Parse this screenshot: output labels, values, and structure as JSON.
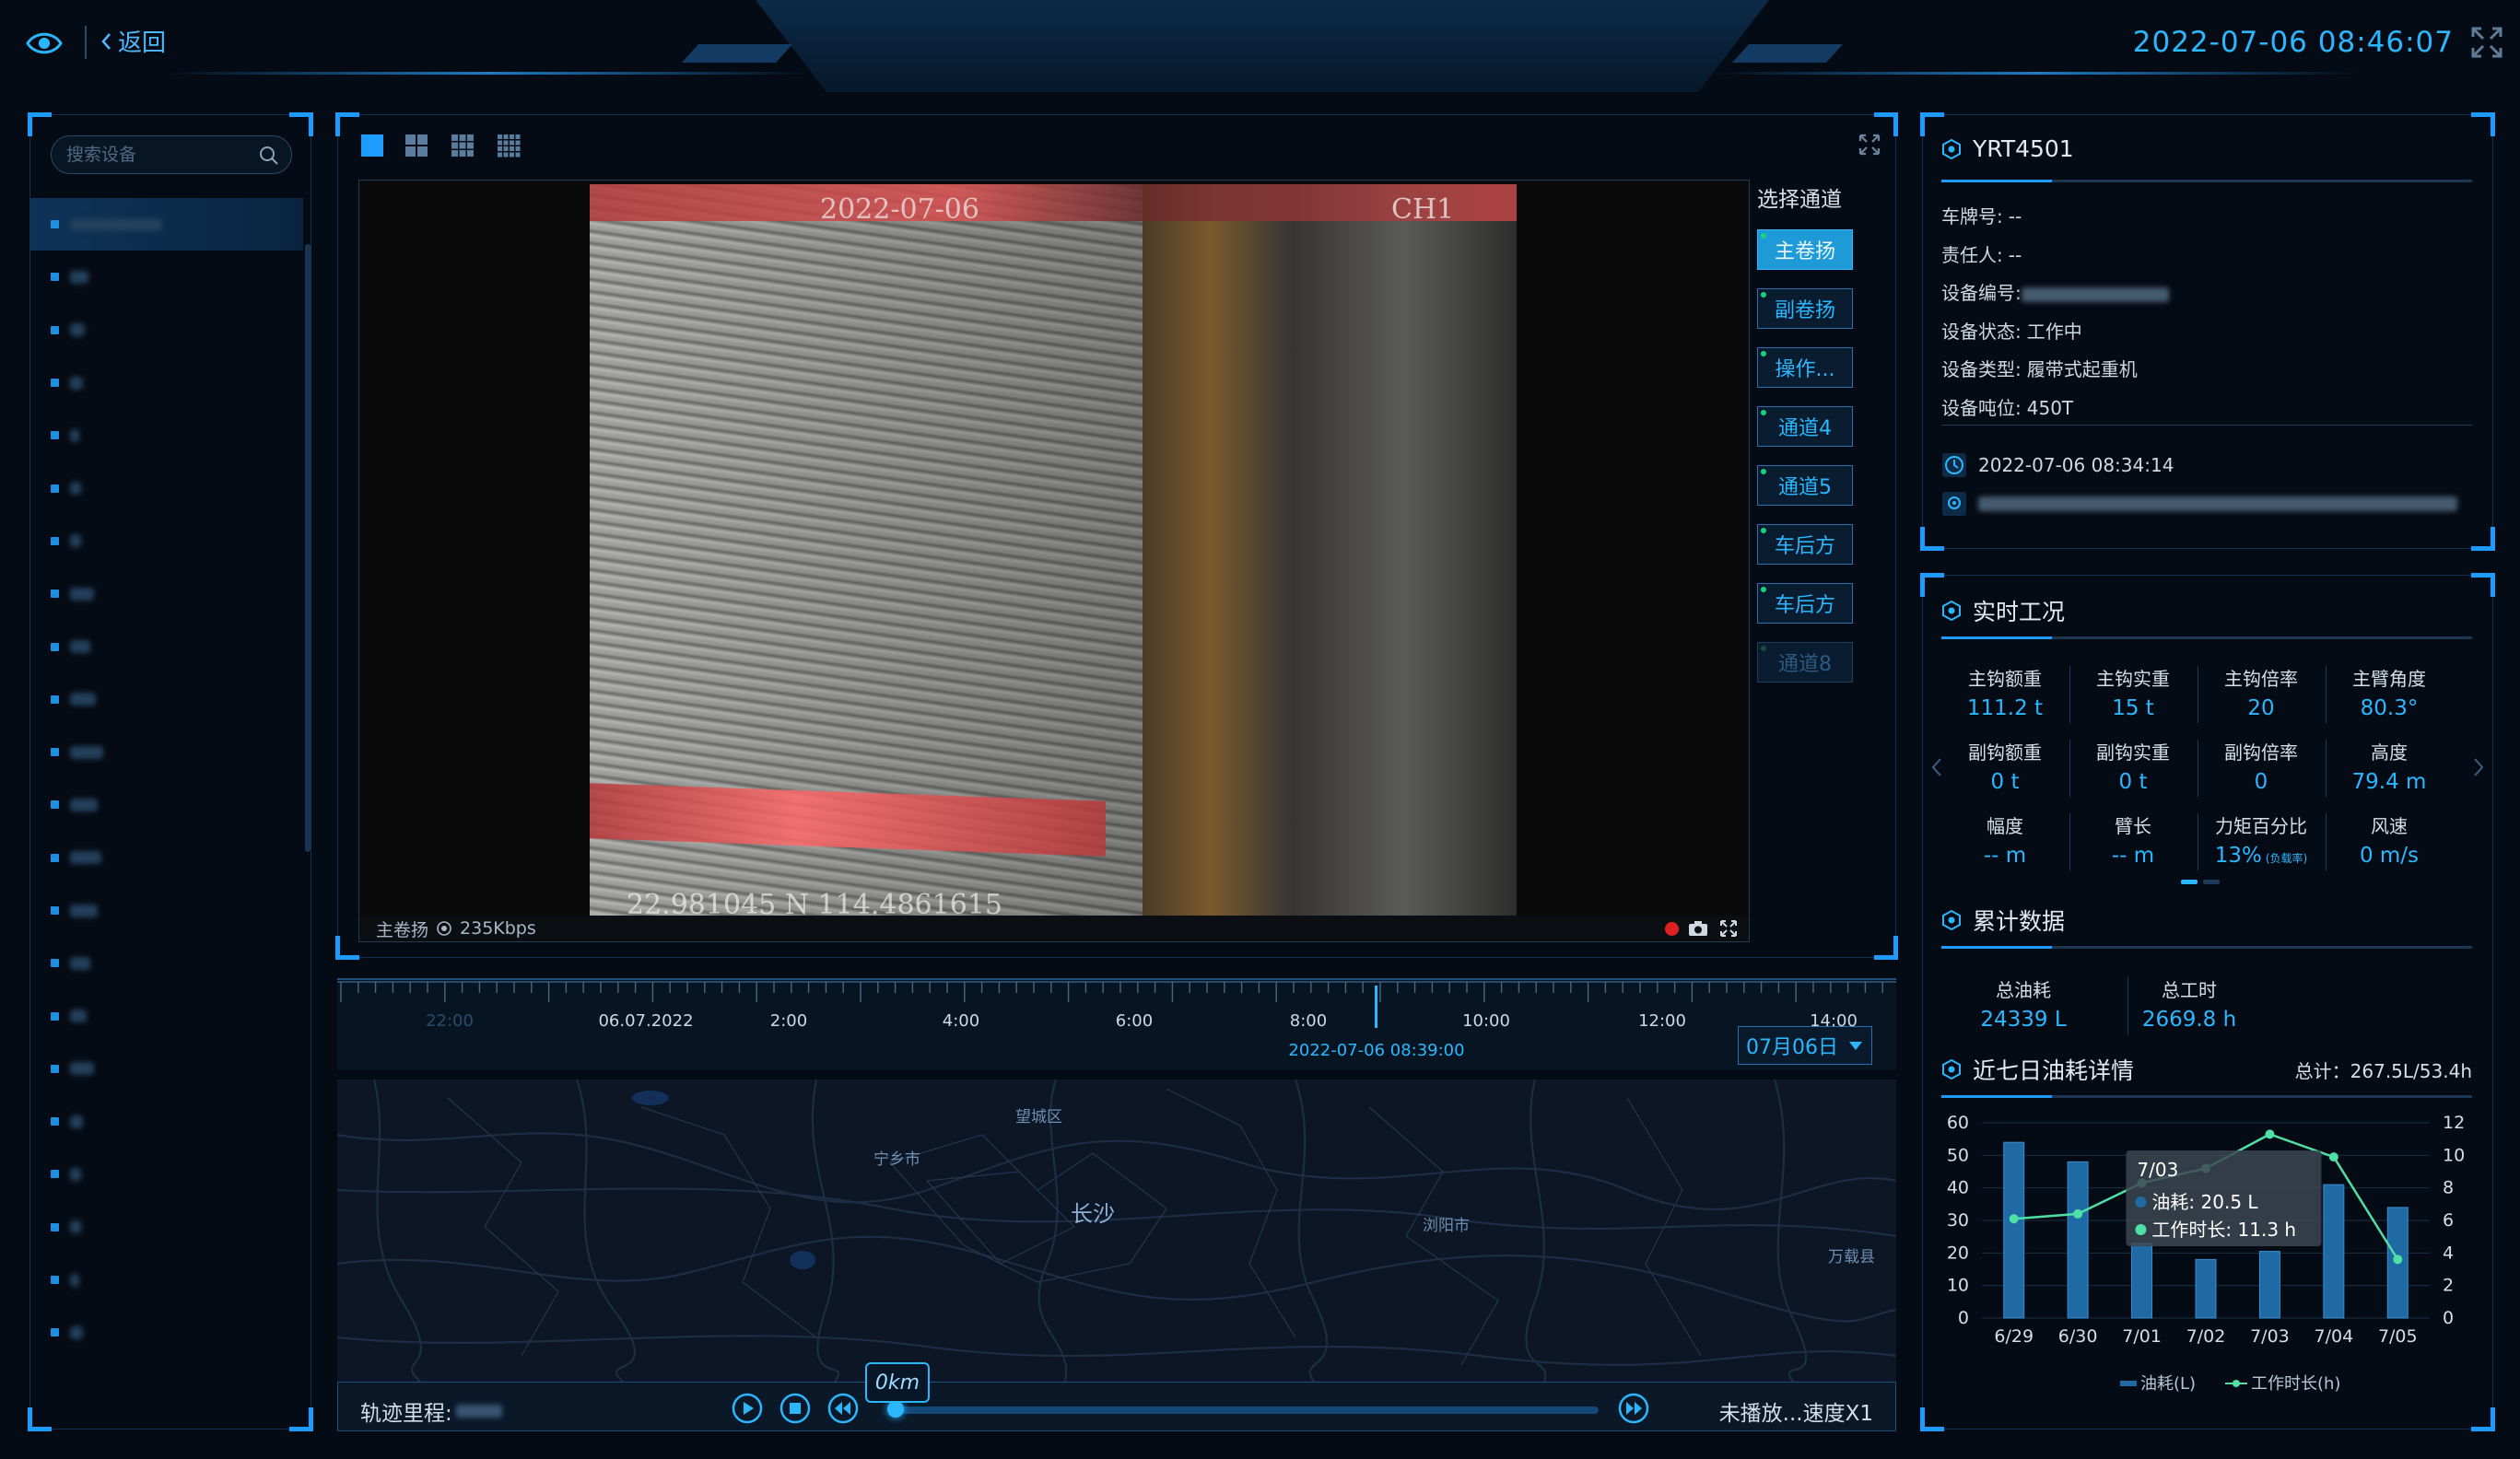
{
  "header": {
    "back_label": "返回",
    "datetime": "2022-07-06 08:46:07"
  },
  "colors": {
    "accent": "#2bb7ff",
    "frame": "#1e9bff",
    "background": "#050b14",
    "online": "#18d27c",
    "record": "#e02020"
  },
  "sidebar": {
    "search_placeholder": "搜索设备",
    "device_count": 22,
    "active_index": 0
  },
  "video": {
    "osd_time": "2022-07-06",
    "osd_channel": "CH1",
    "osd_coord": "22.981045 N 114.4861615",
    "status_channel": "主卷扬",
    "status_bitrate": "235Kbps",
    "layouts": [
      "layout-1-icon",
      "layout-4-icon",
      "layout-9-icon",
      "layout-16-icon"
    ]
  },
  "channels": {
    "title": "选择通道",
    "items": [
      {
        "label": "主卷扬",
        "state": "active"
      },
      {
        "label": "副卷扬",
        "state": "normal"
      },
      {
        "label": "操作...",
        "state": "normal"
      },
      {
        "label": "通道4",
        "state": "normal"
      },
      {
        "label": "通道5",
        "state": "normal"
      },
      {
        "label": "车后方",
        "state": "normal"
      },
      {
        "label": "车后方",
        "state": "normal"
      },
      {
        "label": "通道8",
        "state": "disabled"
      }
    ]
  },
  "timeline": {
    "labels": [
      {
        "text": "22:00",
        "dim": true
      },
      {
        "text": "06.07.2022",
        "dim": false
      },
      {
        "text": "2:00",
        "dim": false
      },
      {
        "text": "4:00",
        "dim": false
      },
      {
        "text": "6:00",
        "dim": false
      },
      {
        "text": "8:00",
        "dim": false
      },
      {
        "text": "10:00",
        "dim": false
      },
      {
        "text": "12:00",
        "dim": false
      },
      {
        "text": "14:00",
        "dim": false
      }
    ],
    "playhead_time": "2022-07-06 08:39:00",
    "date_selected": "07月06日"
  },
  "map": {
    "labels": [
      "望城区",
      "宁乡市",
      "长沙",
      "浏阳市",
      "万载县"
    ]
  },
  "track": {
    "label": "轨迹里程:",
    "distance": "0km",
    "progress": 0.01,
    "status": "未播放...速度X1"
  },
  "device_info": {
    "name": "YRT4501",
    "rows": [
      {
        "label": "车牌号:",
        "value": "--"
      },
      {
        "label": "责任人:",
        "value": "--"
      },
      {
        "label": "设备编号:",
        "value": ""
      },
      {
        "label": "设备状态:",
        "value": "工作中"
      },
      {
        "label": "设备类型:",
        "value": "履带式起重机"
      },
      {
        "label": "设备吨位:",
        "value": "450T"
      }
    ],
    "last_time": "2022-07-06 08:34:14"
  },
  "realtime": {
    "title": "实时工况",
    "cells": [
      {
        "k": "主钩额重",
        "v": "111.2 t"
      },
      {
        "k": "主钩实重",
        "v": "15 t"
      },
      {
        "k": "主钩倍率",
        "v": "20"
      },
      {
        "k": "主臂角度",
        "v": "80.3°"
      },
      {
        "k": "副钩额重",
        "v": "0 t"
      },
      {
        "k": "副钩实重",
        "v": "0 t"
      },
      {
        "k": "副钩倍率",
        "v": "0"
      },
      {
        "k": "高度",
        "v": "79.4 m"
      },
      {
        "k": "幅度",
        "v": "-- m"
      },
      {
        "k": "臂长",
        "v": "-- m"
      },
      {
        "k": "力矩百分比",
        "v": "13%",
        "note": "(负载率)"
      },
      {
        "k": "风速",
        "v": "0 m/s"
      }
    ]
  },
  "cumulative": {
    "title": "累计数据",
    "cells": [
      {
        "k": "总油耗",
        "v": "24339 L"
      },
      {
        "k": "总工时",
        "v": "2669.8 h"
      }
    ]
  },
  "fuel": {
    "title": "近七日油耗详情",
    "total": "总计：267.5L/53.4h"
  },
  "chart_data": {
    "type": "bar",
    "categories": [
      "6/29",
      "6/30",
      "7/01",
      "7/02",
      "7/03",
      "7/04",
      "7/05"
    ],
    "series": [
      {
        "name": "油耗(L)",
        "type": "bar",
        "axis": "left",
        "values": [
          54,
          48,
          23,
          18,
          20.5,
          41,
          34
        ]
      },
      {
        "name": "工作时长(h)",
        "type": "line",
        "axis": "right",
        "values": [
          6.1,
          6.4,
          8.3,
          9.2,
          11.3,
          9.9,
          3.6
        ]
      }
    ],
    "y_left": {
      "min": 0,
      "max": 60,
      "ticks": [
        0,
        10,
        20,
        30,
        40,
        50,
        60
      ]
    },
    "y_right": {
      "min": 0,
      "max": 12,
      "ticks": [
        0,
        2,
        4,
        6,
        8,
        10,
        12
      ]
    },
    "tooltip": {
      "title": "7/03",
      "lines": [
        "油耗:  20.5  L",
        "工作时长:  11.3  h"
      ]
    },
    "legend": "bottom",
    "colors": {
      "bar": "#1f6aa5",
      "line": "#4fe0a6"
    }
  }
}
